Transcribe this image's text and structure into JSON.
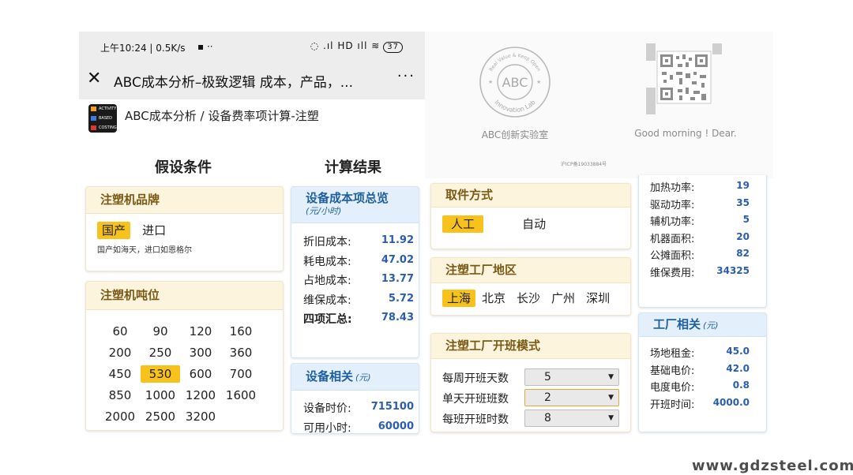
{
  "status_bar": {
    "time": "上午10:24 | 0.5K/s",
    "extra": "▪ ··",
    "icons": "◌ .ıl HD ıll  ≋",
    "battery": "37"
  },
  "title_bar": {
    "close": "✕",
    "title": "ABC成本分析–极致逻辑 成本，产品，...",
    "more": "···"
  },
  "breadcrumb": {
    "logo_lines": [
      "ACTIVITY",
      "BASED",
      "COSTING"
    ],
    "text": "ABC成本分析 / 设备费率项计算-注塑"
  },
  "banner": {
    "stamp_center": "ABC",
    "stamp_top": "Real Value & Keep Open",
    "stamp_bottom": "Innovation Lab",
    "stamp_caption": "ABC创新实验室",
    "greeting": "Good morning ! Dear.",
    "icp": "沪ICP备19033884号"
  },
  "columns": {
    "assume": "假设条件",
    "result": "计算结果"
  },
  "brand": {
    "title": "注塑机品牌",
    "options": [
      "国产",
      "进口"
    ],
    "selected": "国产",
    "note": "国产如海天，进口如恩格尔"
  },
  "tonnage": {
    "title": "注塑机吨位",
    "rows": [
      [
        "60",
        "90",
        "120",
        "160"
      ],
      [
        "200",
        "250",
        "300",
        "360"
      ],
      [
        "450",
        "530",
        "600",
        "700"
      ],
      [
        "850",
        "1000",
        "1200",
        "1600"
      ],
      [
        "2000",
        "2500",
        "3200"
      ]
    ],
    "selected": "530"
  },
  "cost_overview": {
    "title": "设备成本项总览",
    "unit": "(元/小时)",
    "items": [
      {
        "label": "折旧成本:",
        "value": "11.92"
      },
      {
        "label": "耗电成本:",
        "value": "47.02"
      },
      {
        "label": "占地成本:",
        "value": "13.77"
      },
      {
        "label": "维保成本:",
        "value": "5.72"
      },
      {
        "label": "四项汇总:",
        "value": "78.43"
      }
    ]
  },
  "equipment": {
    "title": "设备相关",
    "unit": "(元)",
    "items": [
      {
        "label": "设备时价:",
        "value": "715100"
      },
      {
        "label": "可用小时:",
        "value": "60000"
      }
    ]
  },
  "pickup": {
    "title": "取件方式",
    "options": [
      "人工",
      "自动"
    ],
    "selected": "人工"
  },
  "region": {
    "title": "注塑工厂地区",
    "options": [
      "上海",
      "北京",
      "长沙",
      "广州",
      "深圳"
    ],
    "selected": "上海"
  },
  "shift": {
    "title": "注塑工厂开班模式",
    "rows": [
      {
        "label": "每周开班天数",
        "value": "5"
      },
      {
        "label": "单天开班班数",
        "value": "2"
      },
      {
        "label": "每班开班时数",
        "value": "8"
      }
    ],
    "arrow": "▼"
  },
  "machine_params": {
    "items": [
      {
        "label": "加热功率:",
        "value": "19"
      },
      {
        "label": "驱动功率:",
        "value": "35"
      },
      {
        "label": "辅机功率:",
        "value": "5"
      },
      {
        "label": "机器面积:",
        "value": "20"
      },
      {
        "label": "公摊面积:",
        "value": "82"
      },
      {
        "label": "维保费用:",
        "value": "34325"
      }
    ]
  },
  "factory": {
    "title": "工厂相关",
    "unit": "(元)",
    "items": [
      {
        "label": "场地租金:",
        "value": "45.0"
      },
      {
        "label": "基础电价:",
        "value": "42.0"
      },
      {
        "label": "电度电价:",
        "value": "0.8"
      },
      {
        "label": "开班时间:",
        "value": "4000.0"
      }
    ]
  },
  "watermark": "www.gdzsteel.com"
}
